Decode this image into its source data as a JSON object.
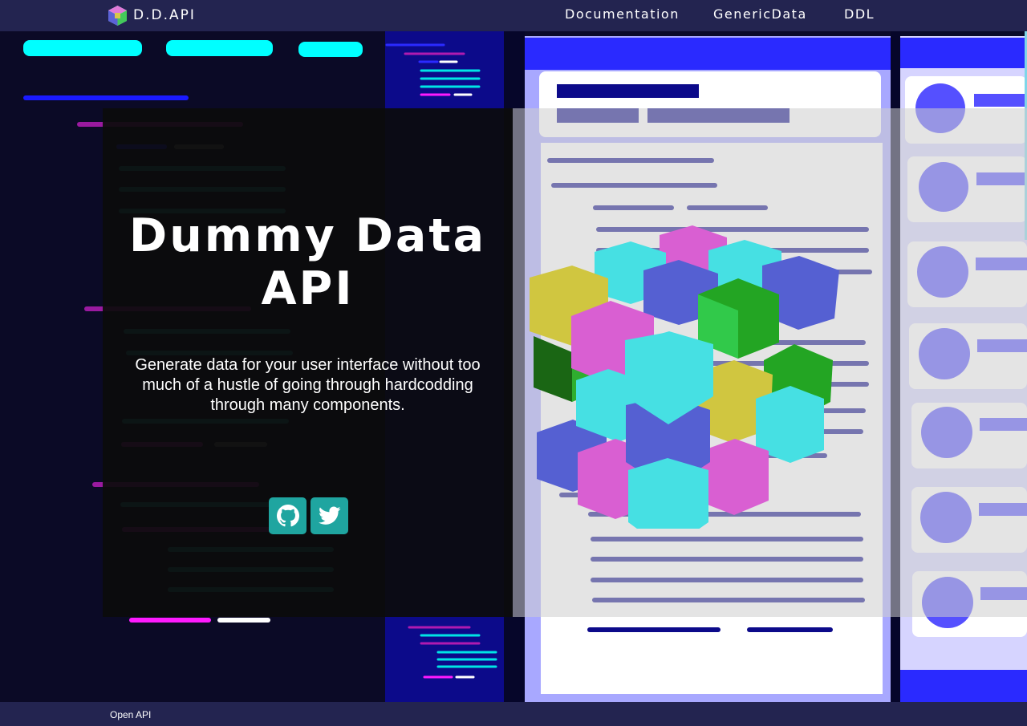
{
  "header": {
    "brand_title": "D.D.API",
    "brand_logo": "cube-logo-icon",
    "nav": [
      {
        "label": "Documentation"
      },
      {
        "label": "GenericData"
      },
      {
        "label": "DDL"
      }
    ]
  },
  "hero": {
    "title": "Dummy Data API",
    "subtitle": "Generate data for your user interface without too much of a hustle of going through hardcodding through many components.",
    "social": [
      {
        "icon": "github-icon"
      },
      {
        "icon": "twitter-icon"
      }
    ],
    "background_illustration": "cube-data-illustration"
  },
  "footer": {
    "link_label": "Open API"
  },
  "colors": {
    "header_bg": "#232450",
    "overlay_bg": "#0c0c0c",
    "social_bg": "#1fa5a0",
    "code_pane_bg": "#0b0a26",
    "accent_blue": "#2a2aff",
    "accent_cyan": "#00ffff"
  }
}
